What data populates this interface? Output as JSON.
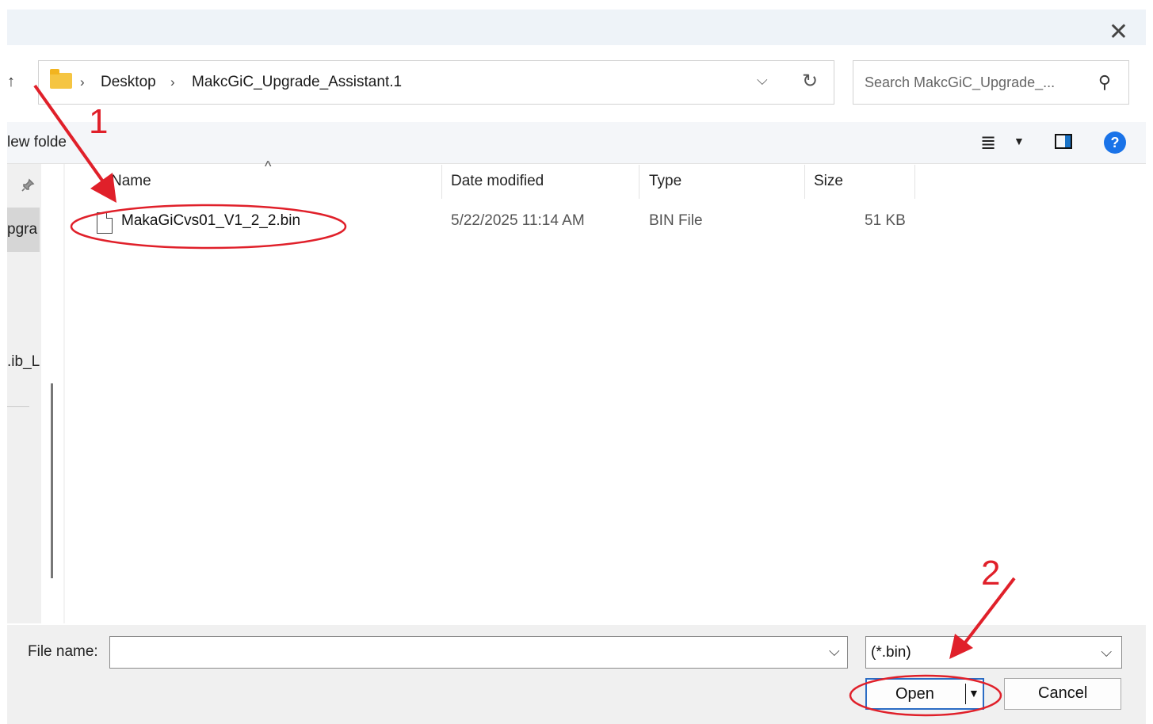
{
  "window": {
    "close_glyph": "✕"
  },
  "nav": {
    "up_glyph": "↑"
  },
  "address": {
    "crumbs": [
      "Desktop",
      "MakcGiC_Upgrade_Assistant.1"
    ],
    "separator": "›",
    "dropdown_glyph": "⌵",
    "refresh_glyph": "↻"
  },
  "search": {
    "placeholder": "Search MakcGiC_Upgrade_...",
    "icon_glyph": "⚲"
  },
  "toolbar": {
    "new_folder_label": "lew folde",
    "view_glyph": "≣",
    "caret_glyph": "▼",
    "help_label": "?"
  },
  "navpane": {
    "pin_glyph": "📌",
    "items": [
      "pgra",
      ".ib_L"
    ]
  },
  "columns": {
    "name": "Name",
    "date": "Date modified",
    "type": "Type",
    "size": "Size",
    "sort_glyph": "^"
  },
  "files": [
    {
      "name": "MakaGiCvs01_V1_2_2.bin",
      "date": "5/22/2025 11:14 AM",
      "type": "BIN File",
      "size": "51 KB"
    }
  ],
  "bottom": {
    "file_name_label": "File name:",
    "file_name_value": "",
    "chevron_glyph": "⌵",
    "filter_value": "(*.bin)",
    "open_label": "Open",
    "open_caret": "▼",
    "cancel_label": "Cancel"
  },
  "annotations": {
    "step1_label": "1",
    "step2_label": "2",
    "color": "#e0202a"
  }
}
